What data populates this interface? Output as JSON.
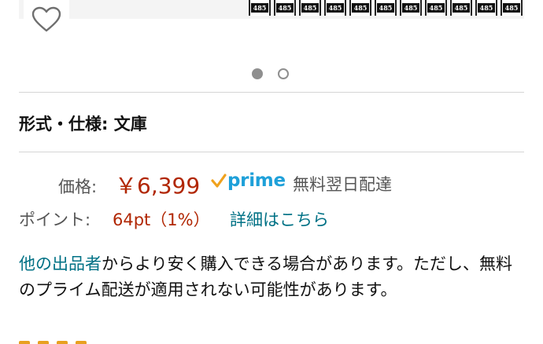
{
  "gallery": {
    "spine_labels": [
      "485",
      "485",
      "485",
      "485",
      "485",
      "485",
      "485",
      "485",
      "485",
      "485",
      "485"
    ],
    "dots": [
      {
        "active": true
      },
      {
        "active": false
      }
    ]
  },
  "format": {
    "label": "形式・仕様: ",
    "value": "文庫"
  },
  "price": {
    "label": "価格:",
    "value": "￥6,399",
    "prime_label": "prime",
    "delivery": "無料翌日配達",
    "color": "#b12704"
  },
  "points": {
    "label": "ポイント:",
    "value": "64pt（1%）",
    "link": "詳細はこちら"
  },
  "notice": {
    "link": "他の出品者",
    "text": "からより安く購入できる場合があります。ただし、無料のプライム配送が適用されない可能性があります。"
  },
  "colors": {
    "price": "#b12704",
    "link": "#007185",
    "prime": "#1ea0d9",
    "check": "#f0a21d"
  }
}
